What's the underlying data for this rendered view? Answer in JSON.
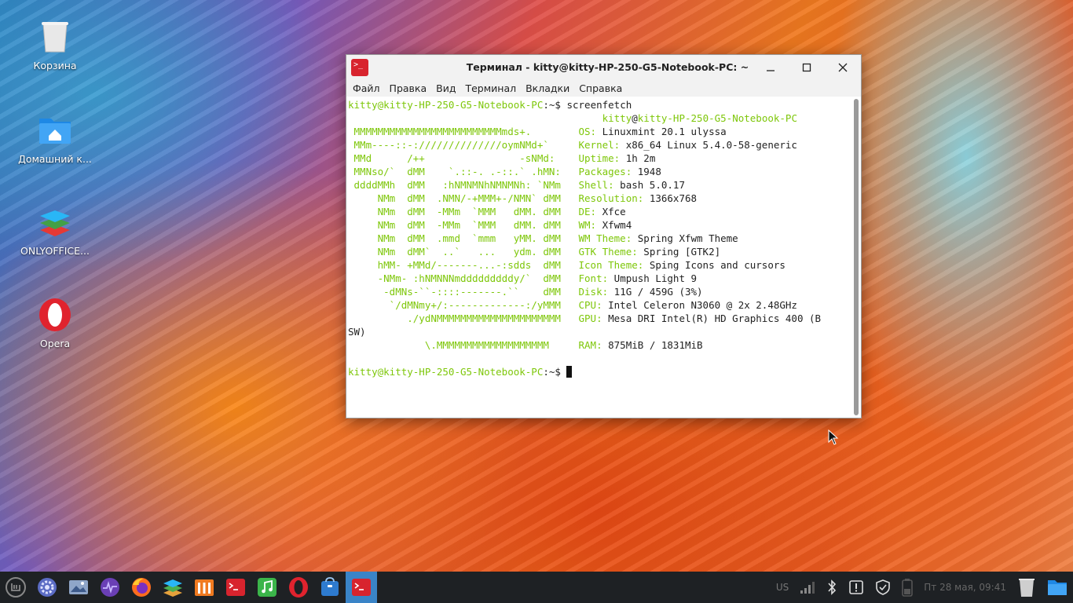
{
  "desktop": {
    "icons": [
      {
        "label": "Корзина"
      },
      {
        "label": "Домашний к..."
      },
      {
        "label": "ONLYOFFICE..."
      },
      {
        "label": "Opera"
      }
    ]
  },
  "window": {
    "title": "Терминал - kitty@kitty-HP-250-G5-Notebook-PC: ~",
    "menu": [
      "Файл",
      "Правка",
      "Вид",
      "Терминал",
      "Вкладки",
      "Справка"
    ]
  },
  "terminal": {
    "prompt_user": "kitty@kitty-HP-250-G5-Notebook-PC",
    "prompt_suffix": ":~$ ",
    "command": "screenfetch",
    "host_user": "kitty",
    "host_at": "@",
    "host_name": "kitty-HP-250-G5-Notebook-PC",
    "art": [
      " MMMMMMMMMMMMMMMMMMMMMMMMMmds+.",
      " MMm----::-://////////////oymNMd+`",
      " MMd      /++                -sNMd:",
      " MMNso/`  dMM    `.::-. .-::.` .hMN:",
      " ddddMMh  dMM   :hNMNMNhNMNMNh: `NMm",
      "     NMm  dMM  .NMN/-+MMM+-/NMN` dMM",
      "     NMm  dMM  -MMm  `MMM   dMM. dMM",
      "     NMm  dMM  -MMm  `MMM   dMM. dMM",
      "     NMm  dMM  .mmd  `mmm   yMM. dMM",
      "     NMm  dMM`  ..`   ...   ydm. dMM",
      "     hMM- +MMd/-------...-:sdds  dMM",
      "     -NMm- :hNMNNNmdddddddddy/`  dMM",
      "      -dMNs-``-::::-------.``    dMM",
      "       `/dMNmy+/:-------------:/yMMM",
      "          ./ydNMMMMMMMMMMMMMMMMMMMMM",
      "",
      "             \\.MMMMMMMMMMMMMMMMMMM"
    ],
    "info": [
      {
        "key": "OS:",
        "value": " Linuxmint 20.1 ulyssa"
      },
      {
        "key": "Kernel:",
        "value": " x86_64 Linux 5.4.0-58-generic"
      },
      {
        "key": "Uptime:",
        "value": " 1h 2m"
      },
      {
        "key": "Packages:",
        "value": " 1948"
      },
      {
        "key": "Shell:",
        "value": " bash 5.0.17"
      },
      {
        "key": "Resolution:",
        "value": " 1366x768"
      },
      {
        "key": "DE:",
        "value": " Xfce"
      },
      {
        "key": "WM:",
        "value": " Xfwm4"
      },
      {
        "key": "WM Theme:",
        "value": " Spring Xfwm Theme"
      },
      {
        "key": "GTK Theme:",
        "value": " Spring [GTK2]"
      },
      {
        "key": "Icon Theme:",
        "value": " Sping Icons and cursors"
      },
      {
        "key": "Font:",
        "value": " Umpush Light 9"
      },
      {
        "key": "Disk:",
        "value": " 11G / 459G (3%)"
      },
      {
        "key": "CPU:",
        "value": " Intel Celeron N3060 @ 2x 2.48GHz"
      },
      {
        "key": "GPU:",
        "value": " Mesa DRI Intel(R) HD Graphics 400 (B"
      },
      {
        "key": "",
        "value": ""
      },
      {
        "key": "RAM:",
        "value": " 875MiB / 1831MiB"
      }
    ],
    "wrap_line": "SW)"
  },
  "panel": {
    "launchers": [
      "mint-menu-icon",
      "settings-icon",
      "image-viewer-icon",
      "system-monitor-icon",
      "firefox-icon",
      "onlyoffice-icon",
      "file-manager-icon",
      "terminal-icon",
      "music-icon",
      "opera-icon",
      "software-store-icon",
      "terminal-active-icon"
    ],
    "keyboard_layout": "US",
    "clock": "Пт 28 мая, 09:41"
  },
  "colors": {
    "prompt_green": "#7ec70a",
    "panel_bg": "#1e2124",
    "active_blue": "#3a84c7"
  }
}
